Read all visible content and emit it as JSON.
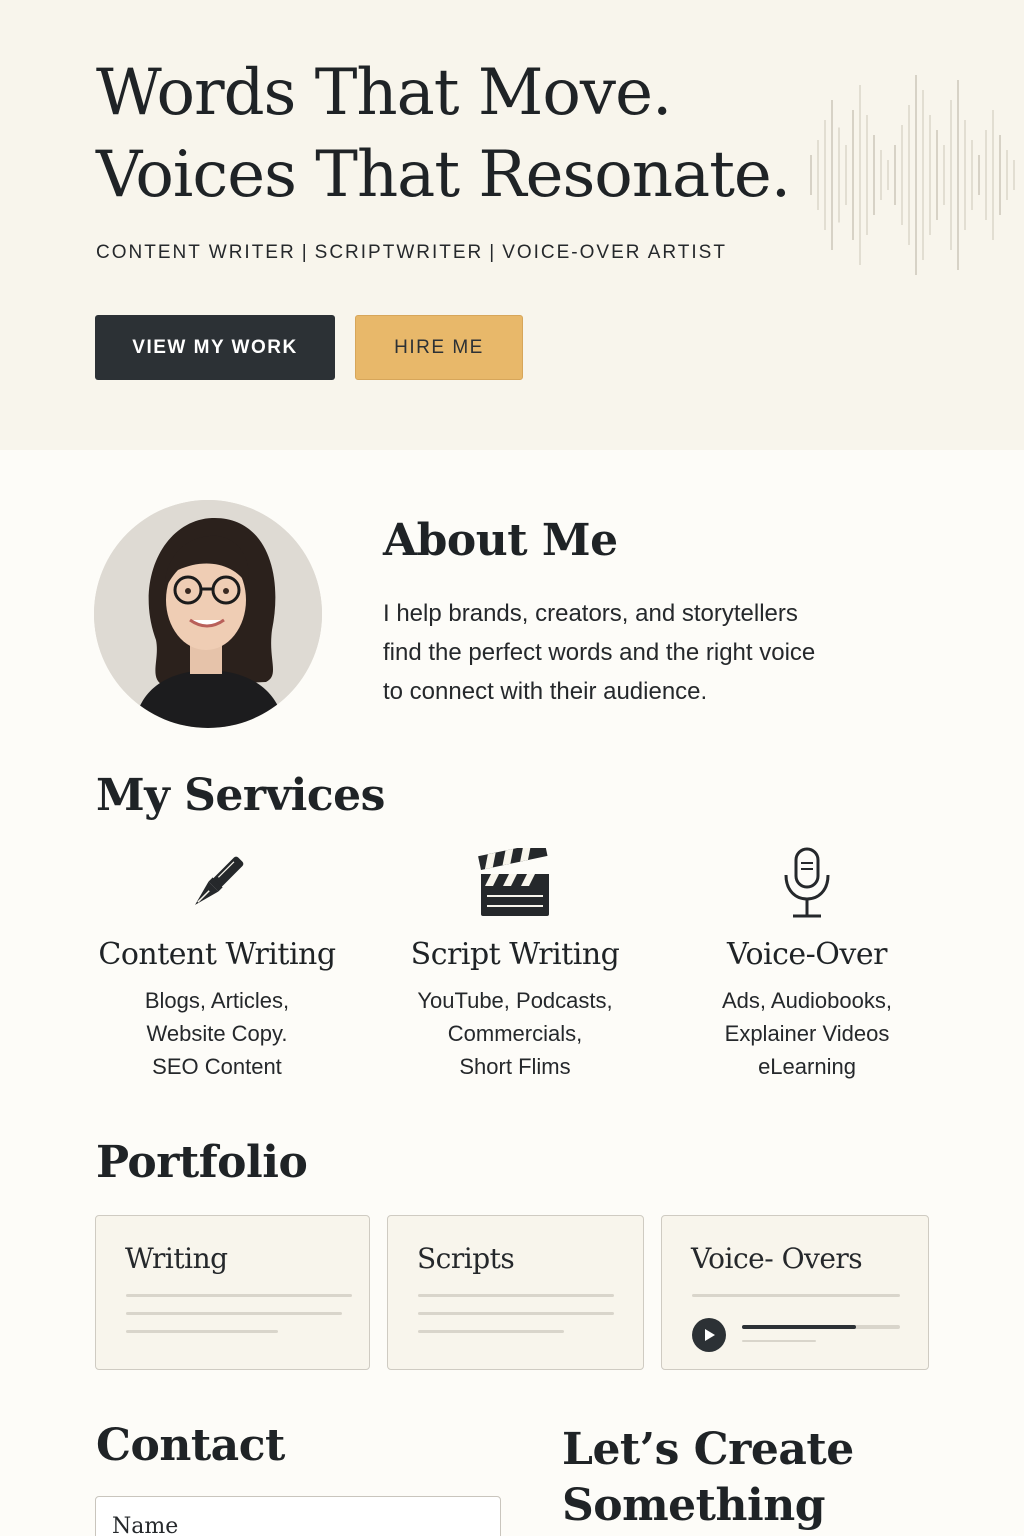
{
  "hero": {
    "title_line1": "Words That Move.",
    "title_line2": "Voices That Resonate.",
    "roles": [
      "CONTENT WRITER",
      "SCRIPTWRITER",
      "VOICE-OVER ARTIST"
    ],
    "separator": "|",
    "primary_button": "VIEW MY WORK",
    "secondary_button": "HIRE ME"
  },
  "about": {
    "title": "About Me",
    "text_lines": [
      "I help brands, creators, and storytellers",
      "find the perfect words and the right voice",
      "to connect with their audience."
    ]
  },
  "services": {
    "title": "My Services",
    "items": [
      {
        "icon": "fountain-pen-icon",
        "name": "Content Writing",
        "lines": [
          "Blogs, Articles,",
          "Website Copy.",
          "SEO Content"
        ]
      },
      {
        "icon": "clapperboard-icon",
        "name": "Script Writing",
        "lines": [
          "YouTube, Podcasts,",
          "Commercials,",
          "Short Flims"
        ]
      },
      {
        "icon": "microphone-icon",
        "name": "Voice-Over",
        "lines": [
          "Ads, Audiobooks,",
          "Explainer Videos",
          "eLearning"
        ]
      }
    ]
  },
  "portfolio": {
    "title": "Portfolio",
    "cards": [
      {
        "title": "Writing"
      },
      {
        "title": "Scripts"
      },
      {
        "title": "Voice- Overs",
        "audio_progress": 0.72
      }
    ]
  },
  "contact": {
    "title": "Contact",
    "name_placeholder": "Name"
  },
  "cta": {
    "line1": "Let’s Create",
    "line2": "Something"
  },
  "colors": {
    "hero_bg": "#f8f5ec",
    "page_bg": "#fdfcf8",
    "dark": "#2c3135",
    "gold": "#e8b86a"
  }
}
